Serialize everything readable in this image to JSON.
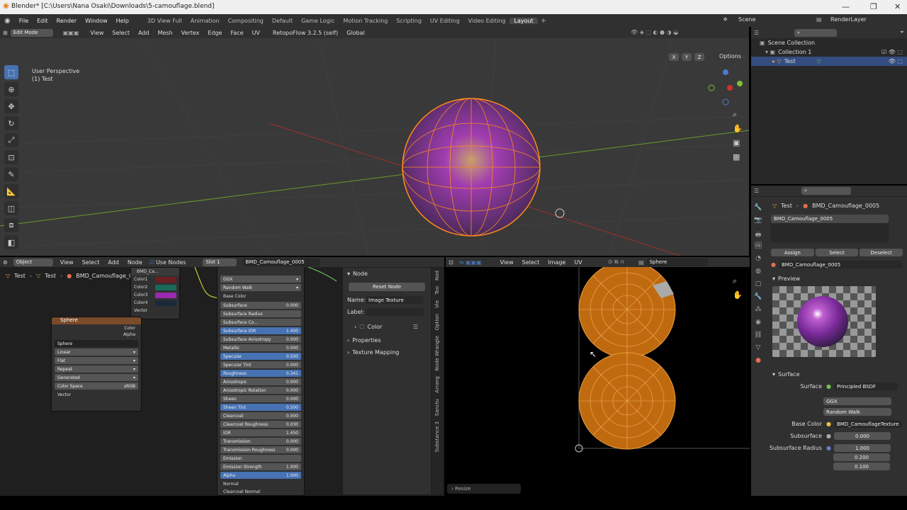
{
  "window": {
    "title": "Blender* [C:\\Users\\Nana Osaki\\Downloads\\5-camouflage.blend]",
    "minimize": "—",
    "maximize": "❐",
    "close": "✕"
  },
  "menus": [
    "File",
    "Edit",
    "Render",
    "Window",
    "Help"
  ],
  "workspaces": [
    "3D View Full",
    "Animation",
    "Compositing",
    "Default",
    "Game Logic",
    "Motion Tracking",
    "Scripting",
    "UV Editing",
    "Video Editing",
    "Layout"
  ],
  "active_workspace": "Layout",
  "scene": "Scene",
  "render_layer": "RenderLayer",
  "viewport": {
    "mode": "Edit Mode",
    "menus": [
      "View",
      "Select",
      "Add",
      "Mesh",
      "Vertex",
      "Edge",
      "Face",
      "UV"
    ],
    "addon": "RetopoFlow 3.2.5 (self)",
    "orientation": "Global",
    "perspective": "User Perspective",
    "object_label": "(1) Test",
    "options": "Options",
    "xyz": [
      "X",
      "Y",
      "Z"
    ]
  },
  "outliner": {
    "root": "Scene Collection",
    "collection": "Collection 1",
    "object": "Test"
  },
  "node_editor": {
    "mode": "Object",
    "menus": [
      "View",
      "Select",
      "Add",
      "Node"
    ],
    "use_nodes": "Use Nodes",
    "slot": "Slot 1",
    "material": "BMD_Camouflage_0005",
    "breadcrumb": [
      "Test",
      "Test",
      "BMD_Camouflage_0005"
    ],
    "color_node": {
      "name": "BMD_Ca...",
      "outputs": [
        "Color1",
        "Color2",
        "Color3",
        "Color4",
        "Vector"
      ]
    },
    "image_node": {
      "title": "Sphere",
      "outputs": [
        "Color",
        "Alpha"
      ],
      "image": "Sphere",
      "interp": "Linear",
      "proj": "Flat",
      "ext": "Repeat",
      "source": "Generated",
      "colorspace_label": "Color Space",
      "colorspace": "sRGB",
      "input": "Vector"
    },
    "bsdf": {
      "dist": "GGX",
      "sss": "Random Walk",
      "base_color": "Base Color",
      "fields": [
        {
          "label": "Subsurface",
          "value": "0.000",
          "hl": false
        },
        {
          "label": "Subsurface Radius",
          "value": "",
          "hl": false
        },
        {
          "label": "Subsurface Co...",
          "value": "",
          "hl": false
        },
        {
          "label": "Subsurface IOR",
          "value": "1.400",
          "hl": true
        },
        {
          "label": "Subsurface Anisotropy",
          "value": "0.000",
          "hl": false
        },
        {
          "label": "Metallic",
          "value": "0.000",
          "hl": false
        },
        {
          "label": "Specular",
          "value": "0.500",
          "hl": true
        },
        {
          "label": "Specular Tint",
          "value": "0.000",
          "hl": false
        },
        {
          "label": "Roughness",
          "value": "0.341",
          "hl": true
        },
        {
          "label": "Anisotropic",
          "value": "0.000",
          "hl": false
        },
        {
          "label": "Anisotropic Rotation",
          "value": "0.000",
          "hl": false
        },
        {
          "label": "Sheen",
          "value": "0.000",
          "hl": false
        },
        {
          "label": "Sheen Tint",
          "value": "0.500",
          "hl": true
        },
        {
          "label": "Clearcoat",
          "value": "0.000",
          "hl": false
        },
        {
          "label": "Clearcoat Roughness",
          "value": "0.030",
          "hl": false
        },
        {
          "label": "IOR",
          "value": "1.450",
          "hl": false
        },
        {
          "label": "Transmission",
          "value": "0.000",
          "hl": false
        },
        {
          "label": "Transmission Roughness",
          "value": "0.000",
          "hl": false
        },
        {
          "label": "Emission",
          "value": "",
          "hl": false
        },
        {
          "label": "Emission Strength",
          "value": "1.000",
          "hl": false
        },
        {
          "label": "Alpha",
          "value": "1.000",
          "hl": true
        }
      ],
      "normal": "Normal",
      "clearcoat_normal": "Clearcoat Normal"
    },
    "side_panel": {
      "section": "Node",
      "reset": "Reset Node",
      "name_label": "Name:",
      "name_value": "Image Texture",
      "label_label": "Label:",
      "color": "Color",
      "properties": "Properties",
      "texture_mapping": "Texture Mapping"
    },
    "side_tabs": [
      "Nod",
      "Too",
      "Vie",
      "Option",
      "Node Wrangle",
      "Arrang",
      "Sanctu",
      "Substance 3"
    ]
  },
  "uv_editor": {
    "menus": [
      "View",
      "Select",
      "Image",
      "UV"
    ],
    "image": "Sphere",
    "operator": "Resize"
  },
  "properties": {
    "breadcrumb": [
      "Test",
      "BMD_Camouflage_0005"
    ],
    "slot_item": "BMD_Camouflage_0005",
    "assign": "Assign",
    "select": "Select",
    "deselect": "Deselect",
    "material": "BMD_Camouflage_0005",
    "preview": "Preview",
    "surface_section": "Surface",
    "surface_label": "Surface",
    "surface_value": "Principled BSDF",
    "dist": "GGX",
    "sss": "Random Walk",
    "base_color_label": "Base Color",
    "base_color_value": "BMD_CamouflageTexture",
    "subsurface_label": "Subsurface",
    "subsurface_value": "0.000",
    "radius_label": "Subsurface Radius",
    "radius": [
      "1.000",
      "0.200",
      "0.100"
    ]
  }
}
